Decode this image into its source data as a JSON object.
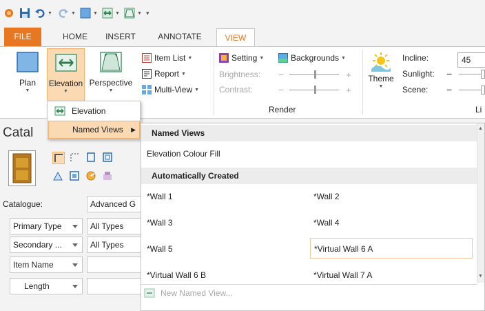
{
  "colors": {
    "accent": "#e87722",
    "highlight": "#fbd9b2",
    "highlight_border": "#f3b16b"
  },
  "tabs": [
    {
      "label": "FILE"
    },
    {
      "label": "HOME"
    },
    {
      "label": "INSERT"
    },
    {
      "label": "ANNOTATE"
    },
    {
      "label": "VIEW"
    }
  ],
  "ribbon": {
    "plan_label": "Plan",
    "elevation_label": "Elevation",
    "perspective_label": "Perspective",
    "item_list_label": "Item List",
    "report_label": "Report",
    "multi_view_label": "Multi-View",
    "setting_label": "Setting",
    "backgrounds_label": "Backgrounds",
    "brightness_label": "Brightness:",
    "contrast_label": "Contrast:",
    "render_group_label": "Render",
    "theme_label": "Theme",
    "incline_label": "Incline:",
    "incline_value": "45",
    "sunlight_label": "Sunlight:",
    "scene_label": "Scene:",
    "partial_group_label": "Li"
  },
  "menu": {
    "elevation_label": "Elevation",
    "named_views_label": "Named Views"
  },
  "left_panel": {
    "title": "Catal",
    "catalogue_label": "Catalogue:",
    "catalogue_value": "Advanced G",
    "primary_type_label": "Primary Type",
    "primary_type_value": "All Types",
    "secondary_label": "Secondary ...",
    "secondary_value": "All Types",
    "item_name_label": "Item Name",
    "item_name_value": "",
    "length_label": "Length",
    "length_value": ""
  },
  "gallery": {
    "named_views_header": "Named Views",
    "named_views": [
      "Elevation Colour Fill"
    ],
    "auto_header": "Automatically Created",
    "auto_items": [
      "*Wall 1",
      "*Wall 2",
      "*Wall 3",
      "*Wall 4",
      "*Wall 5",
      "*Virtual Wall 6 A",
      "*Virtual Wall 6 B",
      "*Virtual Wall 7 A"
    ],
    "new_named_view_label": "New Named View..."
  }
}
